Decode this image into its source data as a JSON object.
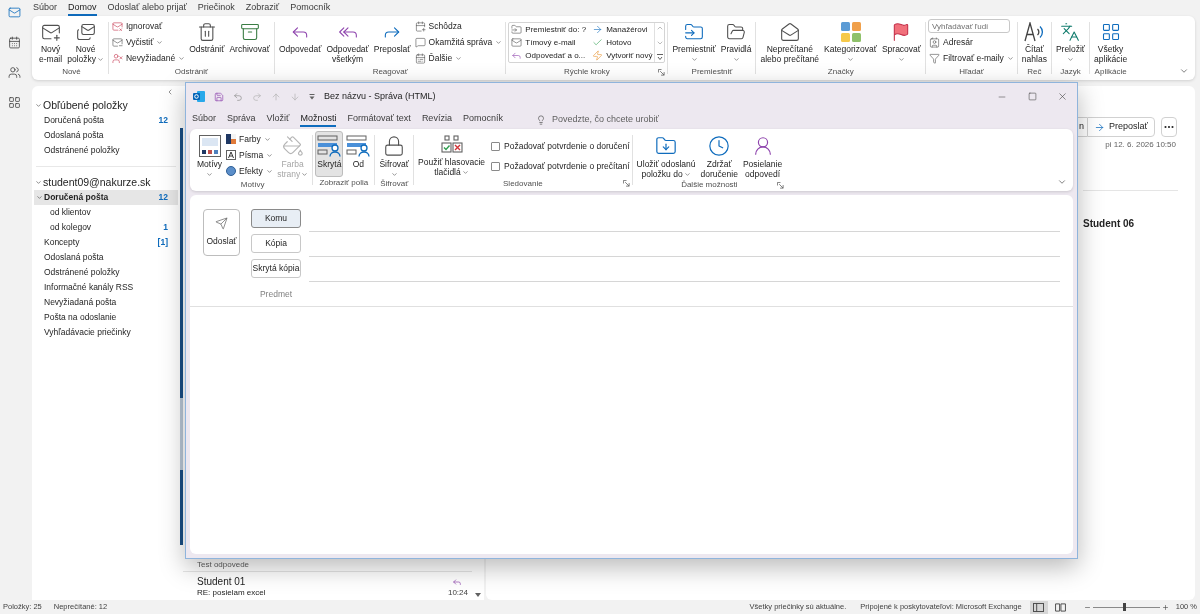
{
  "nav_rail": [
    {
      "kind": "mail",
      "selected": true
    },
    {
      "kind": "calendar",
      "selected": false
    },
    {
      "kind": "people",
      "selected": false
    },
    {
      "kind": "apps",
      "selected": false
    }
  ],
  "tabs": [
    {
      "label": "Súbor",
      "selected": false
    },
    {
      "label": "Domov",
      "selected": true
    },
    {
      "label": "Odoslať alebo prijať",
      "selected": false
    },
    {
      "label": "Priečinok",
      "selected": false
    },
    {
      "label": "Zobraziť",
      "selected": false
    },
    {
      "label": "Pomocník",
      "selected": false
    }
  ],
  "ribbon": {
    "groups": [
      {
        "label": "Nové",
        "items": [
          {
            "kind": "large",
            "label": "Nový\ne-mail",
            "dropdown": false
          },
          {
            "kind": "large",
            "label": "Nové\npoložky",
            "dropdown": true
          }
        ]
      },
      {
        "label": "Odstrániť",
        "items": [
          {
            "kind": "stack",
            "items": [
              {
                "label": "Ignorovať",
                "dropdown": false
              },
              {
                "label": "Vyčistiť",
                "dropdown": true
              },
              {
                "label": "Nevyžiadané",
                "dropdown": true
              }
            ]
          },
          {
            "kind": "large",
            "label": "Odstrániť",
            "dropdown": false
          },
          {
            "kind": "large",
            "label": "Archivovať",
            "dropdown": false
          }
        ]
      },
      {
        "label": "Reagovať",
        "items": [
          {
            "kind": "large",
            "label": "Odpovedať",
            "dropdown": false
          },
          {
            "kind": "large",
            "label": "Odpovedať\nvšetkým",
            "dropdown": false
          },
          {
            "kind": "large",
            "label": "Preposlať",
            "dropdown": false
          },
          {
            "kind": "stack",
            "items": [
              {
                "label": "Schôdza",
                "dropdown": false
              },
              {
                "label": "Okamžitá správa",
                "dropdown": true
              },
              {
                "label": "Ďalšie",
                "dropdown": true
              }
            ]
          }
        ]
      },
      {
        "label": "Rýchle kroky",
        "launcher": true,
        "items": [
          {
            "kind": "gallery",
            "items": [
              {
                "label": "Premiestniť do: ?"
              },
              {
                "label": "Manažérovi"
              },
              {
                "label": "Tímový e-mail"
              },
              {
                "label": "Hotovo"
              },
              {
                "label": "Odpovedať a o..."
              },
              {
                "label": "Vytvoriť nový"
              }
            ]
          }
        ]
      },
      {
        "label": "Premiestniť",
        "items": [
          {
            "kind": "large",
            "label": "Premiestniť",
            "dropdown": true
          },
          {
            "kind": "large",
            "label": "Pravidlá",
            "dropdown": true
          }
        ]
      },
      {
        "label": "Značky",
        "items": [
          {
            "kind": "large",
            "label": "Neprečítané\nalebo prečítané",
            "dropdown": false
          },
          {
            "kind": "large",
            "label": "Kategorizovať",
            "dropdown": true
          },
          {
            "kind": "large",
            "label": "Spracovať",
            "dropdown": true
          }
        ]
      },
      {
        "label": "Hľadať",
        "items": [
          {
            "kind": "stack",
            "items": [
              {
                "kind": "search",
                "placeholder": "Vyhľadávať ľudí"
              },
              {
                "label": "Adresár",
                "dropdown": false
              },
              {
                "label": "Filtrovať e-maily",
                "dropdown": true
              }
            ]
          }
        ]
      },
      {
        "label": "Reč",
        "items": [
          {
            "kind": "large",
            "label": "Čítať\nnahlas",
            "dropdown": false
          }
        ]
      },
      {
        "label": "Jazyk",
        "items": [
          {
            "kind": "large",
            "label": "Preložiť",
            "dropdown": true
          }
        ]
      },
      {
        "label": "Aplikácie",
        "items": [
          {
            "kind": "large",
            "label": "Všetky\naplikácie",
            "dropdown": false
          }
        ]
      }
    ]
  },
  "folder_pane": {
    "sections": [
      {
        "title": "Obľúbené položky",
        "expanded": true,
        "folders": [
          {
            "name": "Doručená pošta",
            "count": "12",
            "selected": false
          },
          {
            "name": "Odoslaná pošta",
            "selected": false
          },
          {
            "name": "Odstránené položky",
            "selected": false
          }
        ]
      },
      {
        "title": "student09@nakurze.sk",
        "expanded": true,
        "folders": [
          {
            "name": "Doručená pošta",
            "count": "12",
            "selected": true,
            "expanded": true,
            "children": [
              {
                "name": "od klientov",
                "selected": false
              },
              {
                "name": "od kolegov",
                "count": "1",
                "selected": false
              }
            ]
          },
          {
            "name": "Koncepty",
            "count": "[1]",
            "selected": false
          },
          {
            "name": "Odoslaná pošta",
            "selected": false
          },
          {
            "name": "Odstránené položky",
            "selected": false
          },
          {
            "name": "Informačné kanály RSS",
            "selected": false
          },
          {
            "name": "Nevyžiadaná pošta",
            "selected": false
          },
          {
            "name": "Pošta na odoslanie",
            "selected": false
          },
          {
            "name": "Vyhľadávacie priečinky",
            "selected": false
          }
        ]
      }
    ]
  },
  "message_list": {
    "preview_fragment": "Test odpovede",
    "items": [
      {
        "sender": "Student 01",
        "subject": "RE: posielam excel",
        "time": "10:24",
        "replied": true
      }
    ]
  },
  "reading_pane": {
    "buttons": [
      {
        "kind": "plain",
        "label": "n"
      },
      {
        "kind": "forward",
        "label": "Preposlať"
      }
    ],
    "date": "pi 12. 6. 2026 10:50",
    "sender": "Student 06"
  },
  "compose_window": {
    "title": "Bez názvu - Správa (HTML)",
    "tabs": [
      {
        "label": "Súbor",
        "selected": false
      },
      {
        "label": "Správa",
        "selected": false
      },
      {
        "label": "Vložiť",
        "selected": false
      },
      {
        "label": "Možnosti",
        "selected": true
      },
      {
        "label": "Formátovať text",
        "selected": false
      },
      {
        "label": "Revízia",
        "selected": false
      },
      {
        "label": "Pomocník",
        "selected": false
      }
    ],
    "tell_me": {
      "placeholder": "Povedzte, čo chcete urobiť"
    },
    "ribbon": {
      "groups": [
        {
          "label": "Motívy",
          "items": [
            {
              "kind": "large",
              "label": "Motívy",
              "dropdown": true,
              "disabled": false
            },
            {
              "kind": "stack",
              "items": [
                {
                  "label": "Farby",
                  "dropdown": true
                },
                {
                  "label": "Písma",
                  "dropdown": true
                },
                {
                  "label": "Efekty",
                  "dropdown": true
                }
              ]
            },
            {
              "kind": "large",
              "label": "Farba\nstrany",
              "dropdown": true,
              "disabled": true
            }
          ]
        },
        {
          "label": "Zobraziť polia",
          "items": [
            {
              "kind": "toggle",
              "label": "Skrytá",
              "selected": true,
              "dropdown": false
            },
            {
              "kind": "toggle",
              "label": "Od",
              "selected": false,
              "dropdown": false
            }
          ]
        },
        {
          "label": "Šifrovať",
          "items": [
            {
              "kind": "large",
              "label": "Šifrovať",
              "dropdown": true,
              "disabled": false
            }
          ]
        },
        {
          "label": "Sledovanie",
          "launcher": true,
          "items": [
            {
              "kind": "large",
              "label": "Použiť hlasovacie\ntlačidlá",
              "dropdown": true,
              "disabled": false
            },
            {
              "kind": "checks",
              "items": [
                {
                  "label": "Požadovať potvrdenie o doručení",
                  "checked": false
                },
                {
                  "label": "Požadovať potvrdenie o prečítaní",
                  "checked": false
                }
              ]
            }
          ]
        },
        {
          "label": "Ďalšie možnosti",
          "launcher": true,
          "items": [
            {
              "kind": "large",
              "label": "Uložiť odoslanú\npoložku do",
              "dropdown": true,
              "disabled": false
            },
            {
              "kind": "large",
              "label": "Zdržať\ndoručenie",
              "dropdown": false,
              "disabled": false
            },
            {
              "kind": "large",
              "label": "Posielanie\nodpovedí",
              "dropdown": false,
              "disabled": false
            }
          ]
        }
      ]
    },
    "send_button": "Odoslať",
    "recipients": [
      {
        "label": "Komu",
        "focused": true
      },
      {
        "label": "Kópia",
        "focused": false
      },
      {
        "label": "Skrytá kópia",
        "focused": false
      }
    ],
    "subject": {
      "label": "Predmet"
    }
  },
  "status_bar": {
    "items": "Položky: 25",
    "unread": "Neprečítané: 12",
    "sync_status": "Všetky priečinky sú aktuálne.",
    "connection": "Pripojené k poskytovateľovi: Microsoft Exchange",
    "views": [
      {
        "kind": "normal",
        "selected": true
      },
      {
        "kind": "reading",
        "selected": false
      }
    ],
    "zoom": {
      "level": 0.47,
      "reading": "100 %"
    }
  }
}
